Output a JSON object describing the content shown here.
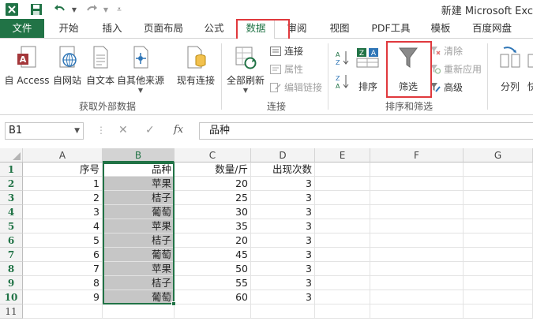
{
  "window": {
    "title": "新建 Microsoft Exc"
  },
  "tabs": [
    "文件",
    "开始",
    "插入",
    "页面布局",
    "公式",
    "数据",
    "审阅",
    "视图",
    "PDF工具",
    "模板",
    "百度网盘"
  ],
  "ribbon": {
    "get_external": {
      "buttons": [
        "自 Access",
        "自网站",
        "自文本",
        "自其他来源",
        "现有连接"
      ],
      "group_label": "获取外部数据"
    },
    "connections": {
      "refresh_all": "全部刷新",
      "items": [
        "连接",
        "属性",
        "编辑链接"
      ],
      "group_label": "连接"
    },
    "sort_filter": {
      "sort": "排序",
      "filter": "筛选",
      "items": [
        "清除",
        "重新应用",
        "高级"
      ],
      "group_label": "排序和筛选"
    },
    "data_tools": {
      "split": "分列",
      "partial": "快"
    }
  },
  "formula_bar": {
    "name_box": "B1",
    "fx": "fx",
    "value": "品种"
  },
  "grid": {
    "columns": [
      "A",
      "B",
      "C",
      "D",
      "E",
      "F",
      "G"
    ],
    "rows": [
      {
        "n": "1",
        "a": "序号",
        "b": "品种",
        "c": "数量/斤",
        "d": "出现次数"
      },
      {
        "n": "2",
        "a": "1",
        "b": "苹果",
        "c": "20",
        "d": "3"
      },
      {
        "n": "3",
        "a": "2",
        "b": "桔子",
        "c": "25",
        "d": "3"
      },
      {
        "n": "4",
        "a": "3",
        "b": "葡萄",
        "c": "30",
        "d": "3"
      },
      {
        "n": "5",
        "a": "4",
        "b": "苹果",
        "c": "35",
        "d": "3"
      },
      {
        "n": "6",
        "a": "5",
        "b": "桔子",
        "c": "20",
        "d": "3"
      },
      {
        "n": "7",
        "a": "6",
        "b": "葡萄",
        "c": "45",
        "d": "3"
      },
      {
        "n": "8",
        "a": "7",
        "b": "苹果",
        "c": "50",
        "d": "3"
      },
      {
        "n": "9",
        "a": "8",
        "b": "桔子",
        "c": "55",
        "d": "3"
      },
      {
        "n": "10",
        "a": "9",
        "b": "葡萄",
        "c": "60",
        "d": "3"
      },
      {
        "n": "11",
        "a": "",
        "b": "",
        "c": "",
        "d": ""
      }
    ]
  },
  "colors": {
    "accent": "#217346",
    "highlight": "#e0393d",
    "selection": "#c6c6c6"
  }
}
